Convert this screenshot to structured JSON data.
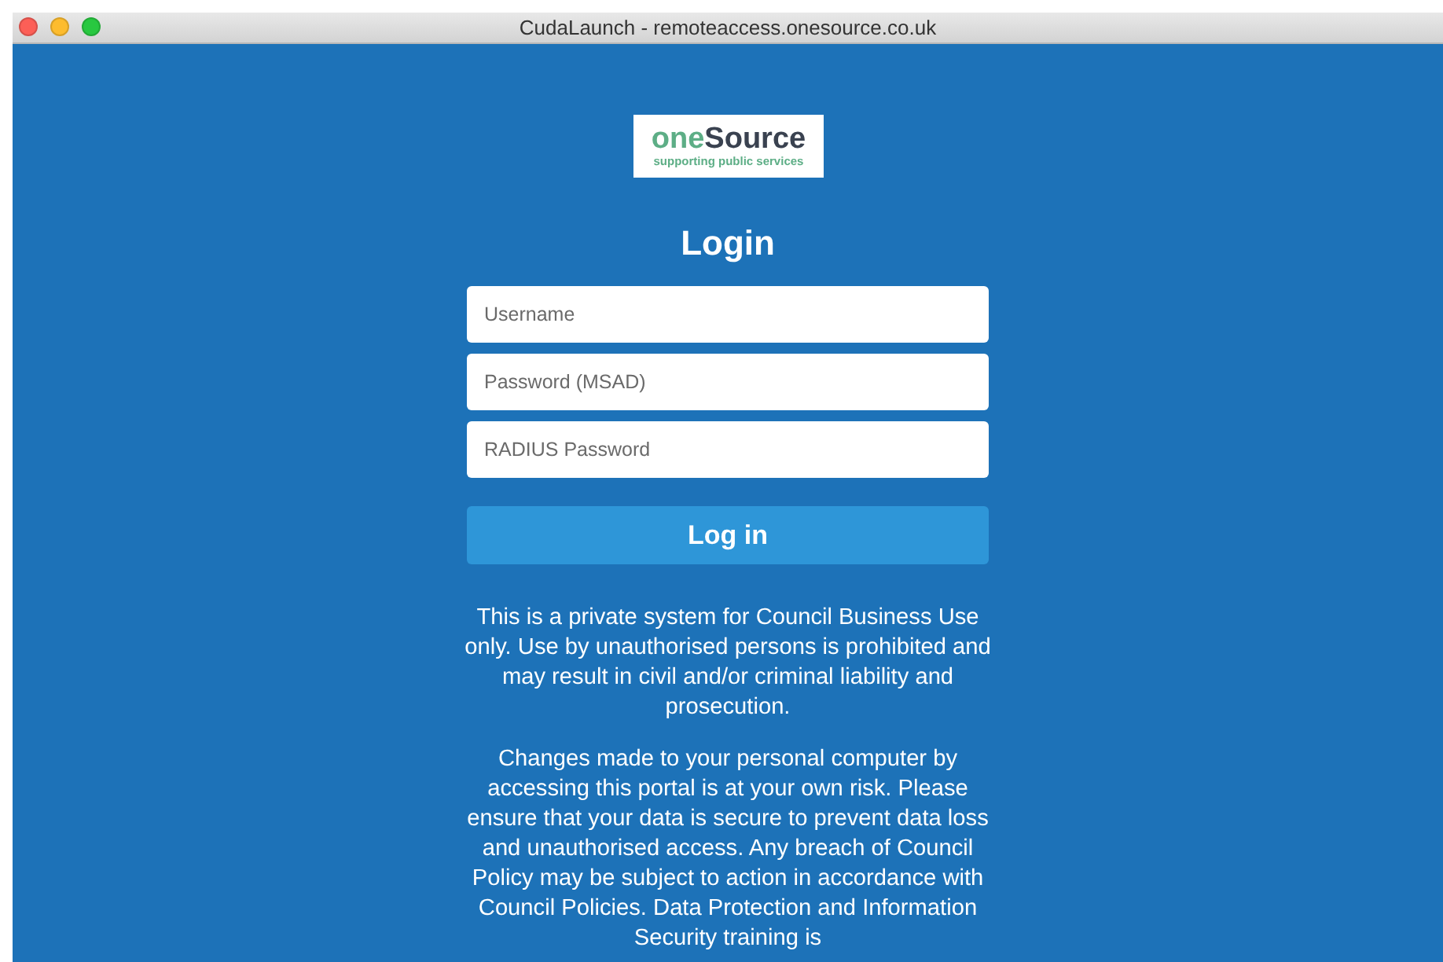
{
  "window": {
    "title": "CudaLaunch - remoteaccess.onesource.co.uk"
  },
  "logo": {
    "name_first": "one",
    "name_second": "Source",
    "tagline": "supporting public services"
  },
  "heading": "Login",
  "fields": [
    {
      "placeholder": "Username"
    },
    {
      "placeholder": "Password (MSAD)"
    },
    {
      "placeholder": "RADIUS Password"
    }
  ],
  "login_button": "Log in",
  "notices": [
    "This is a private system for Council Business Use only. Use by unauthorised persons is prohibited and may result in civil and/or criminal liability and prosecution.",
    "Changes made to your personal computer by accessing this portal is at your own risk. Please ensure that your data is secure to prevent data loss and unauthorised access. Any breach of Council Policy may be subject to action in accordance with Council Policies. Data Protection and Information Security training is"
  ]
}
